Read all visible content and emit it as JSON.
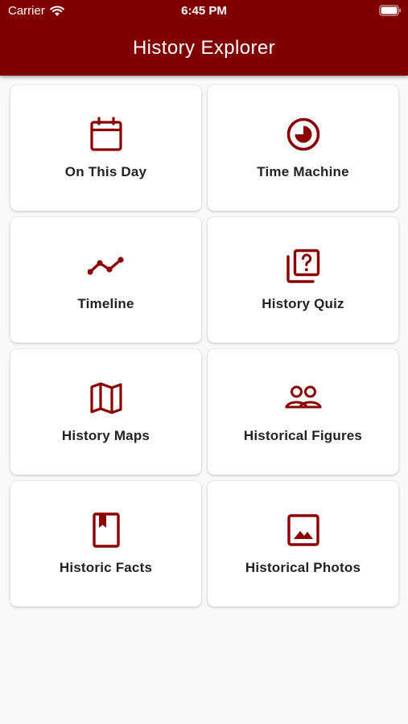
{
  "status_bar": {
    "carrier": "Carrier",
    "time": "6:45 PM",
    "wifi_icon": "wifi-icon",
    "battery_icon": "battery-icon"
  },
  "app_bar": {
    "title": "History Explorer",
    "background_color": "#800000"
  },
  "accent_color": "#8b0000",
  "cards": [
    {
      "label": "On This Day",
      "icon": "calendar-icon"
    },
    {
      "label": "Time Machine",
      "icon": "clock-pie-icon"
    },
    {
      "label": "Timeline",
      "icon": "timeline-icon"
    },
    {
      "label": "History Quiz",
      "icon": "quiz-icon"
    },
    {
      "label": "History Maps",
      "icon": "map-icon"
    },
    {
      "label": "Historical Figures",
      "icon": "people-icon"
    },
    {
      "label": "Historic Facts",
      "icon": "book-icon"
    },
    {
      "label": "Historical Photos",
      "icon": "photo-icon"
    }
  ]
}
